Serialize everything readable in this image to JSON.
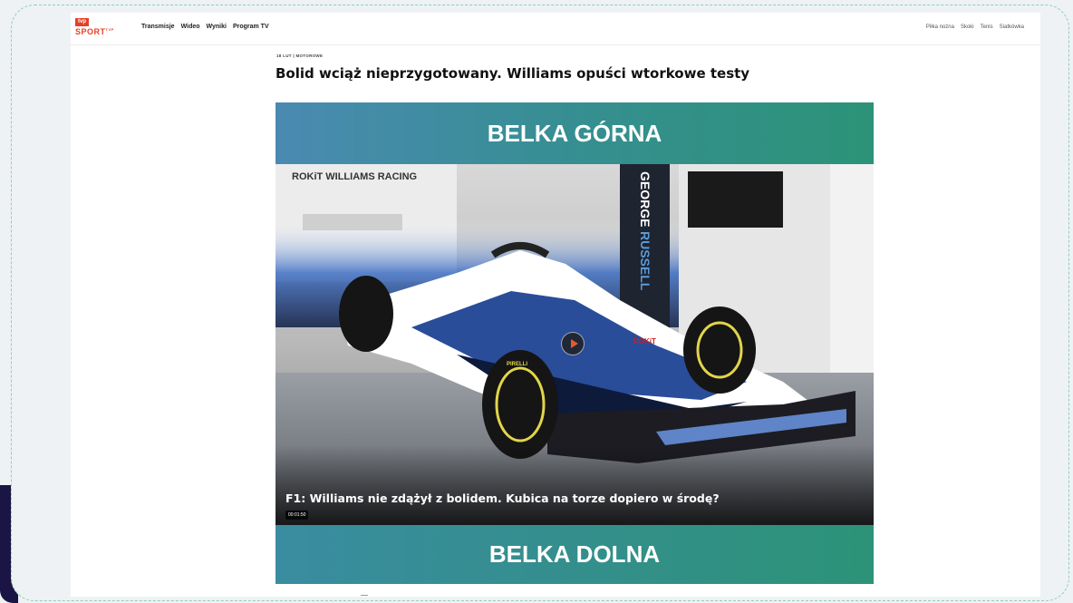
{
  "nav": {
    "logo_box": "tvp",
    "logo_text": "SPORT",
    "logo_sup": "TVP",
    "main_items": [
      "Transmisje",
      "Wideo",
      "Wyniki",
      "Program TV"
    ],
    "right_items": [
      "Piłka nożna",
      "Skoki",
      "Tenis",
      "Siatkówka"
    ]
  },
  "article": {
    "meta": "18 LUT | MOTOROWE",
    "headline": "Bolid wciąż nieprzygotowany. Williams opuści wtorkowe testy"
  },
  "ad": {
    "top_label": "BELKA GÓRNA",
    "bottom_label": "BELKA DOLNA"
  },
  "video": {
    "caption": "F1: Williams nie zdążył z bolidem. Kubica na torze dopiero w środę?",
    "duration": "00:01:50",
    "garage_sign": "ROKiT WILLIAMS RACING",
    "driver_name_a": "GEORGE",
    "driver_name_b": "RUSSELL",
    "car_sponsor": "ROKiT",
    "tyre_brand": "PIRELLI"
  },
  "colors": {
    "brand_red": "#e54027",
    "bar_teal": "#2c9378",
    "bar_blue": "#4a8ab2",
    "frame_dash": "#8fd0b3"
  }
}
